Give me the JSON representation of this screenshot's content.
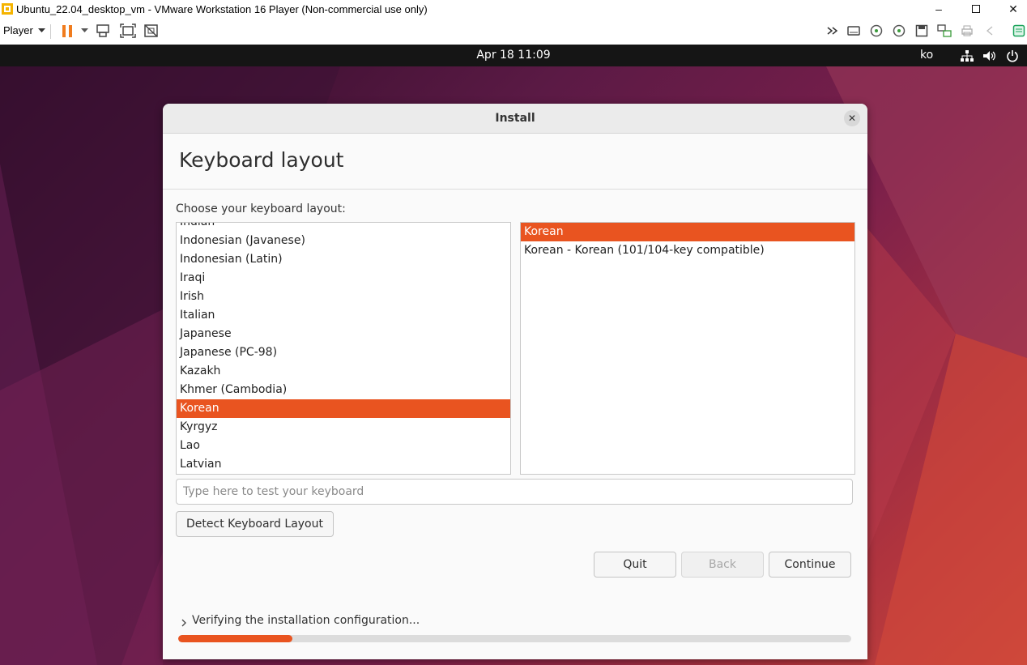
{
  "vmware": {
    "window_title": "Ubuntu_22.04_desktop_vm - VMware Workstation 16 Player (Non-commercial use only)",
    "player_menu": "Player",
    "toolbar_icons": [
      "pause-icon",
      "dropdown-arrow-icon",
      "send-ctrl-alt-del-icon",
      "fullscreen-icon",
      "unity-icon",
      "more-icon",
      "removable-device-icon",
      "cd-icon",
      "cd-icon",
      "floppy-icon",
      "network-icon",
      "printer-icon",
      "sound-icon",
      "message-log-icon"
    ],
    "controls": {
      "minimize": "–",
      "maximize": "◻",
      "close": "✕"
    }
  },
  "ubuntu_bar": {
    "clock": "Apr 18  11:09",
    "input_method": "ko"
  },
  "dialog": {
    "title": "Install",
    "close_label": "✕",
    "page_title": "Keyboard layout",
    "choose_label": "Choose your keyboard layout:",
    "layouts": [
      "Indian",
      "Indonesian (Javanese)",
      "Indonesian (Latin)",
      "Iraqi",
      "Irish",
      "Italian",
      "Japanese",
      "Japanese (PC-98)",
      "Kazakh",
      "Khmer (Cambodia)",
      "Korean",
      "Kyrgyz",
      "Lao",
      "Latvian"
    ],
    "selected_layout_index": 10,
    "variants": [
      "Korean",
      "Korean - Korean (101/104-key compatible)"
    ],
    "selected_variant_index": 0,
    "test_placeholder": "Type here to test your keyboard",
    "detect_button": "Detect Keyboard Layout",
    "quit_button": "Quit",
    "back_button": "Back",
    "continue_button": "Continue",
    "status_text": "Verifying the installation configuration...",
    "progress": 0.17,
    "accent_color": "#e95420"
  }
}
